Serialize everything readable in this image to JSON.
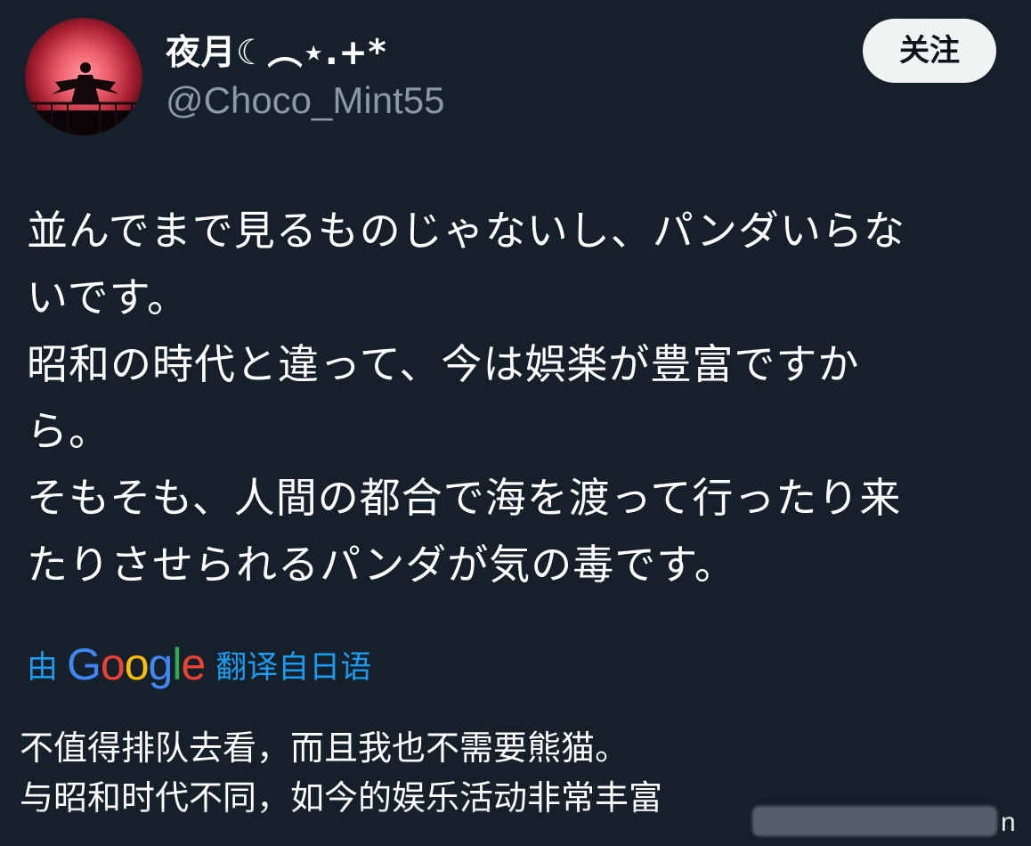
{
  "profile": {
    "display_name": "夜月☾︵⋆.+*",
    "handle": "@Choco_Mint55",
    "avatar_icon": "red-moon-avatar-icon"
  },
  "follow_button": {
    "label": "关注"
  },
  "tweet": {
    "lines": [
      "並んでまで見るものじゃないし、パンダいらな",
      "いです。",
      "昭和の時代と違って、今は娯楽が豊富ですか",
      "ら。",
      "そもそも、人間の都合で海を渡って行ったり来",
      "たりさせられるパンダが気の毒です。"
    ]
  },
  "translation": {
    "prefix": "由",
    "brand": "Google",
    "suffix": "翻译自日语",
    "brand_colors": [
      "#4285F4",
      "#EA4335",
      "#FBBC05",
      "#4285F4",
      "#34A853",
      "#EA4335"
    ],
    "link_color": "#1d9bf0"
  },
  "translated_text": {
    "lines": [
      "不值得排队去看，而且我也不需要熊猫。",
      "与昭和时代不同，如今的娱乐活动非常丰富"
    ]
  },
  "watermark_tail": "n"
}
